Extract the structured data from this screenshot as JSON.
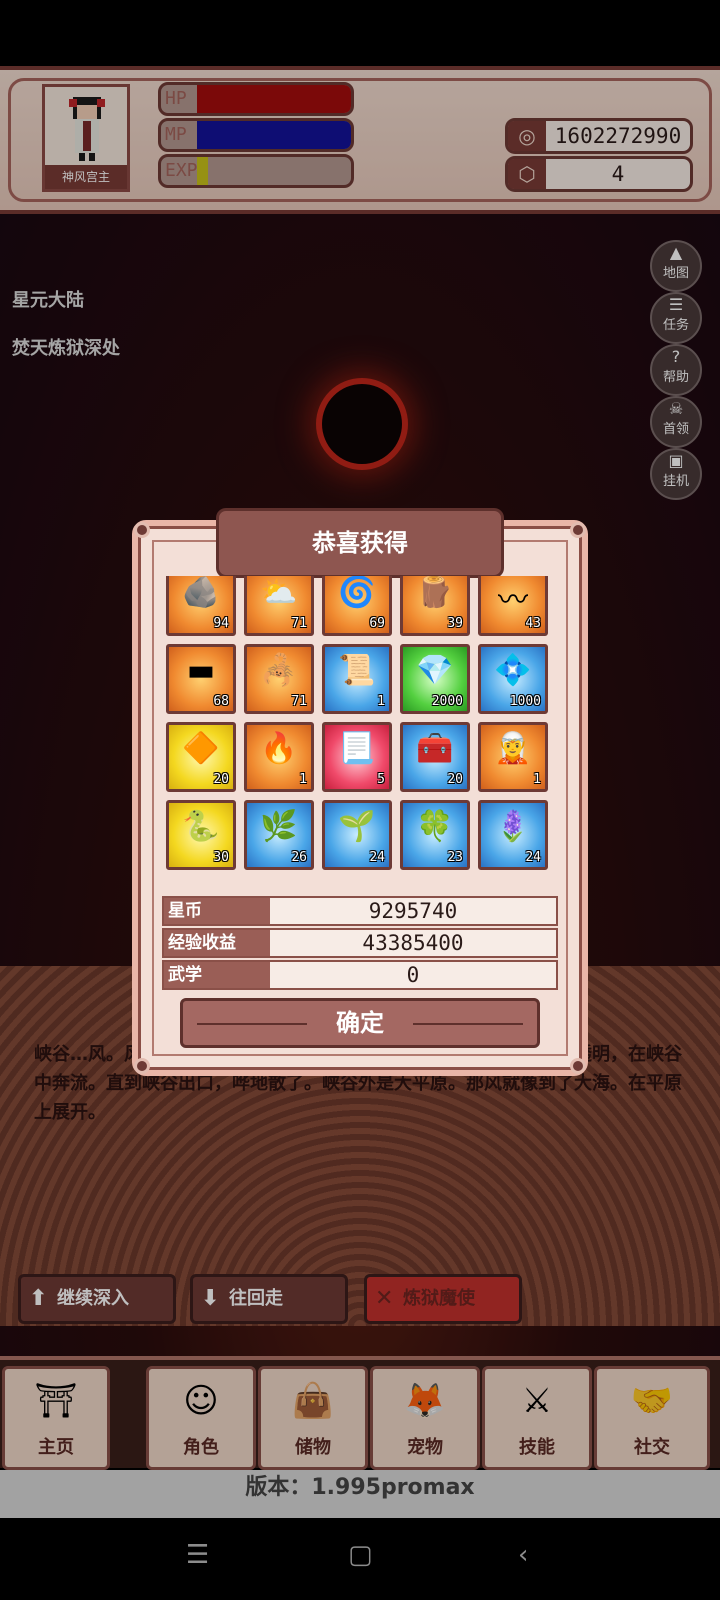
{
  "player": {
    "name": "神风宫主"
  },
  "stats": {
    "hp_label": "HP",
    "mp_label": "MP",
    "exp_label": "EXP",
    "hp_fill": 1.0,
    "mp_fill": 1.0,
    "exp_fill": 0.07
  },
  "resources": {
    "coins": "1602272990",
    "gems": "4"
  },
  "location": {
    "region": "星元大陆",
    "area": "焚天炼狱深处"
  },
  "side_menu": [
    {
      "icon": "▲",
      "label": "地图"
    },
    {
      "icon": "☰",
      "label": "任务"
    },
    {
      "icon": "?",
      "label": "帮助"
    },
    {
      "icon": "☠",
      "label": "首领"
    },
    {
      "icon": "▣",
      "label": "挂机"
    }
  ],
  "story": {
    "text": "峡谷…风。风比水快，风比水深。与峡谷一样深，正及山顶。风比水透明，在峡谷中奔流。直到峡谷出口，哗地散了。峡谷外是大平原。那风就像到了大海。在平原上展开。"
  },
  "actions": {
    "continue": "继续深入",
    "back": "往回走",
    "boss": "炼狱魔使"
  },
  "nav": [
    {
      "label": "主页",
      "icon": "⛩"
    },
    {
      "label": "角色",
      "icon": "☺"
    },
    {
      "label": "储物",
      "icon": "👜"
    },
    {
      "label": "宠物",
      "icon": "🦊"
    },
    {
      "label": "技能",
      "icon": "⚔"
    },
    {
      "label": "社交",
      "icon": "🤝"
    }
  ],
  "version": "版本：1.995promax",
  "reward_modal": {
    "title": "恭喜获得",
    "items": [
      {
        "icon": "🪨",
        "count": "94",
        "bg": "orange"
      },
      {
        "icon": "⛅",
        "count": "71",
        "bg": "orange"
      },
      {
        "icon": "🌀",
        "count": "69",
        "bg": "orange"
      },
      {
        "icon": "🪵",
        "count": "39",
        "bg": "orange"
      },
      {
        "icon": "〰",
        "count": "43",
        "bg": "orange"
      },
      {
        "icon": "▬",
        "count": "68",
        "bg": "orange"
      },
      {
        "icon": "🦂",
        "count": "71",
        "bg": "orange"
      },
      {
        "icon": "📜",
        "count": "1",
        "bg": "blue"
      },
      {
        "icon": "💎",
        "count": "2000",
        "bg": "green"
      },
      {
        "icon": "💠",
        "count": "1000",
        "bg": "blue"
      },
      {
        "icon": "🔶",
        "count": "20",
        "bg": "yellow"
      },
      {
        "icon": "🔥",
        "count": "1",
        "bg": "orange"
      },
      {
        "icon": "📃",
        "count": "5",
        "bg": "red"
      },
      {
        "icon": "🧰",
        "count": "20",
        "bg": "blue"
      },
      {
        "icon": "🧝",
        "count": "1",
        "bg": "orange"
      },
      {
        "icon": "🐍",
        "count": "30",
        "bg": "yellow"
      },
      {
        "icon": "🌿",
        "count": "26",
        "bg": "blue"
      },
      {
        "icon": "🌱",
        "count": "24",
        "bg": "blue"
      },
      {
        "icon": "🍀",
        "count": "23",
        "bg": "blue"
      },
      {
        "icon": "🪻",
        "count": "24",
        "bg": "blue"
      }
    ],
    "rows": [
      {
        "key": "星币",
        "value": "9295740"
      },
      {
        "key": "经验收益",
        "value": "43385400"
      },
      {
        "key": "武学",
        "value": "0"
      }
    ],
    "confirm": "确定"
  },
  "colors": {
    "accent": "#7a3b36",
    "hp": "#a50d0d",
    "mp": "#13129a",
    "exp": "#c8c21a"
  }
}
